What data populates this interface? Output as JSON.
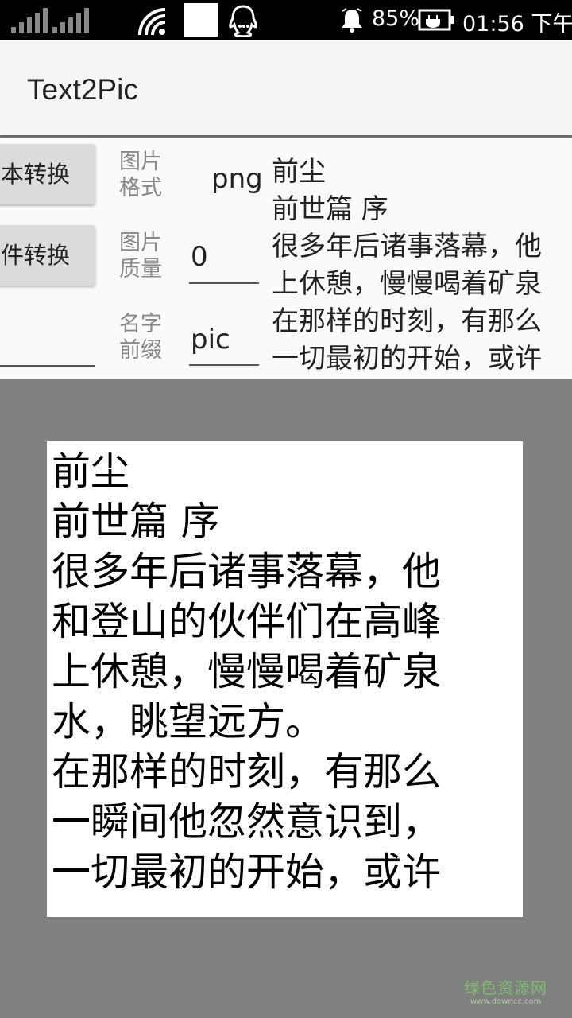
{
  "status_bar": {
    "battery": "85%",
    "time": "01:56 下午",
    "icons": [
      "signal-icon",
      "signal-icon",
      "wifi-icon",
      "notification-square-icon",
      "qq-icon",
      "alarm-bell-icon",
      "charging-battery-icon"
    ]
  },
  "app_bar": {
    "title": "Text2Pic"
  },
  "form": {
    "text_convert_button": "本转换",
    "file_convert_button": "件转换",
    "format_label": "图片\n格式",
    "format_value": "png",
    "quality_label": "图片\n质量",
    "quality_value": "0",
    "prefix_label": "名字\n前缀",
    "prefix_value": "pic"
  },
  "preview_lines": [
    "前尘",
    "前世篇 序",
    "很多年后诸事落幕，他",
    "上休憩，慢慢喝着矿泉",
    "在那样的时刻，有那么",
    "一切最初的开始，或许"
  ],
  "result_lines": [
    "前尘",
    "前世篇 序",
    "很多年后诸事落幕，他",
    "和登山的伙伴们在高峰",
    "上休憩，慢慢喝着矿泉",
    "水，眺望远方。",
    "在那样的时刻，有那么",
    "一瞬间他忽然意识到，",
    "一切最初的开始，或许"
  ],
  "watermark": {
    "text": "绿色资源网",
    "sub": "www.downcc.com"
  }
}
